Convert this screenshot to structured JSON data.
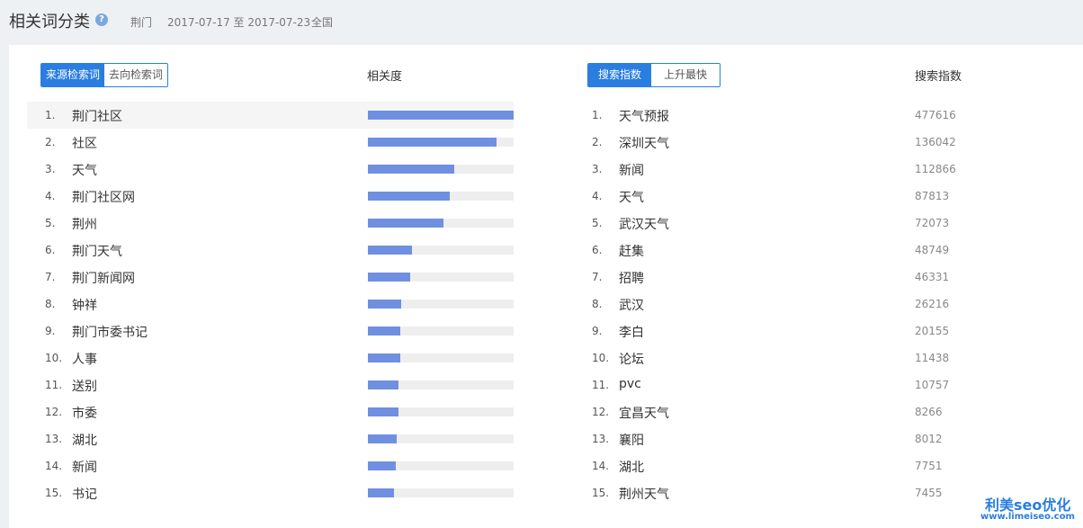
{
  "header": {
    "title": "相关词分类",
    "help_icon": "?",
    "region": "荆门",
    "date_range": "2017-07-17 至 2017-07-23",
    "scope": "全国"
  },
  "left": {
    "tabs": [
      {
        "label": "来源检索词",
        "active": true
      },
      {
        "label": "去向检索词",
        "active": false
      }
    ],
    "column_header": "相关度",
    "bar_color": "#6f8fe0",
    "items": [
      {
        "rank": "1.",
        "keyword": "荆门社区",
        "relevance": 1.0
      },
      {
        "rank": "2.",
        "keyword": "社区",
        "relevance": 0.88
      },
      {
        "rank": "3.",
        "keyword": "天气",
        "relevance": 0.59
      },
      {
        "rank": "4.",
        "keyword": "荆门社区网",
        "relevance": 0.56
      },
      {
        "rank": "5.",
        "keyword": "荆州",
        "relevance": 0.52
      },
      {
        "rank": "6.",
        "keyword": "荆门天气",
        "relevance": 0.3
      },
      {
        "rank": "7.",
        "keyword": "荆门新闻网",
        "relevance": 0.29
      },
      {
        "rank": "8.",
        "keyword": "钟祥",
        "relevance": 0.23
      },
      {
        "rank": "9.",
        "keyword": "荆门市委书记",
        "relevance": 0.22
      },
      {
        "rank": "10.",
        "keyword": "人事",
        "relevance": 0.22
      },
      {
        "rank": "11.",
        "keyword": "送别",
        "relevance": 0.21
      },
      {
        "rank": "12.",
        "keyword": "市委",
        "relevance": 0.21
      },
      {
        "rank": "13.",
        "keyword": "湖北",
        "relevance": 0.2
      },
      {
        "rank": "14.",
        "keyword": "新闻",
        "relevance": 0.19
      },
      {
        "rank": "15.",
        "keyword": "书记",
        "relevance": 0.18
      }
    ]
  },
  "right": {
    "tabs": [
      {
        "label": "搜索指数",
        "active": true
      },
      {
        "label": "上升最快",
        "active": false
      }
    ],
    "column_header": "搜索指数",
    "items": [
      {
        "rank": "1.",
        "keyword": "天气预报",
        "value": "477616"
      },
      {
        "rank": "2.",
        "keyword": "深圳天气",
        "value": "136042"
      },
      {
        "rank": "3.",
        "keyword": "新闻",
        "value": "112866"
      },
      {
        "rank": "4.",
        "keyword": "天气",
        "value": "87813"
      },
      {
        "rank": "5.",
        "keyword": "武汉天气",
        "value": "72073"
      },
      {
        "rank": "6.",
        "keyword": "赶集",
        "value": "48749"
      },
      {
        "rank": "7.",
        "keyword": "招聘",
        "value": "46331"
      },
      {
        "rank": "8.",
        "keyword": "武汉",
        "value": "26216"
      },
      {
        "rank": "9.",
        "keyword": "李白",
        "value": "20155"
      },
      {
        "rank": "10.",
        "keyword": "论坛",
        "value": "11438"
      },
      {
        "rank": "11.",
        "keyword": "pvc",
        "value": "10757"
      },
      {
        "rank": "12.",
        "keyword": "宜昌天气",
        "value": "8266"
      },
      {
        "rank": "13.",
        "keyword": "襄阳",
        "value": "8012"
      },
      {
        "rank": "14.",
        "keyword": "湖北",
        "value": "7751"
      },
      {
        "rank": "15.",
        "keyword": "荆州天气",
        "value": "7455"
      }
    ]
  },
  "watermark": {
    "name": "利美seo优化",
    "url": "www.limeiseo.com"
  }
}
